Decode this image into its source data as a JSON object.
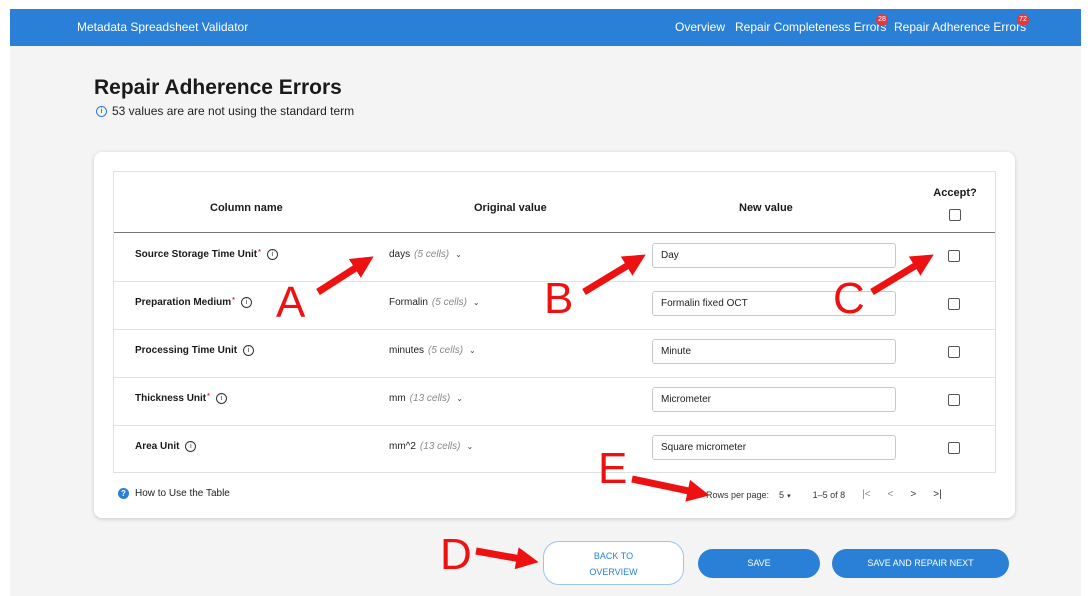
{
  "app": {
    "title": "Metadata Spreadsheet Validator",
    "nav": [
      {
        "label": "Overview"
      },
      {
        "label": "Repair Completeness Errors",
        "badge": "28"
      },
      {
        "label": "Repair Adherence Errors",
        "badge": "72"
      }
    ]
  },
  "page": {
    "title": "Repair Adherence Errors",
    "subtitle": "53 values are are not using the standard term"
  },
  "table": {
    "headers": {
      "column_name": "Column name",
      "original_value": "Original value",
      "new_value": "New value",
      "accept": "Accept?"
    },
    "rows": [
      {
        "name": "Source Storage Time Unit",
        "required": true,
        "orig": "days",
        "cells": "(5 cells)",
        "new_value": "Day"
      },
      {
        "name": "Preparation Medium",
        "required": true,
        "orig": "Formalin",
        "cells": "(5 cells)",
        "new_value": "Formalin fixed OCT"
      },
      {
        "name": "Processing Time Unit",
        "required": false,
        "orig": "minutes",
        "cells": "(5 cells)",
        "new_value": "Minute"
      },
      {
        "name": "Thickness Unit",
        "required": true,
        "orig": "mm",
        "cells": "(13 cells)",
        "new_value": "Micrometer"
      },
      {
        "name": "Area Unit",
        "required": false,
        "orig": "mm^2",
        "cells": "(13 cells)",
        "new_value": "Square micrometer"
      }
    ]
  },
  "footer": {
    "help": "How to Use the Table",
    "rows_per_page_label": "Rows per page:",
    "rows_per_page": "5",
    "range": "1–5 of 8"
  },
  "buttons": {
    "back_line1": "BACK TO",
    "back_line2": "OVERVIEW",
    "save": "SAVE",
    "save_next": "SAVE AND REPAIR NEXT"
  },
  "callouts": [
    "A",
    "B",
    "C",
    "D",
    "E"
  ],
  "colors": {
    "primary": "#2a7fd6",
    "badge": "#e0393e",
    "annotation": "#ee1111"
  },
  "icons": {
    "info": "info-icon",
    "help": "help-icon",
    "dropdown": "chevron-down-icon",
    "pagination": [
      "first-page-icon",
      "prev-page-icon",
      "next-page-icon",
      "last-page-icon"
    ]
  }
}
